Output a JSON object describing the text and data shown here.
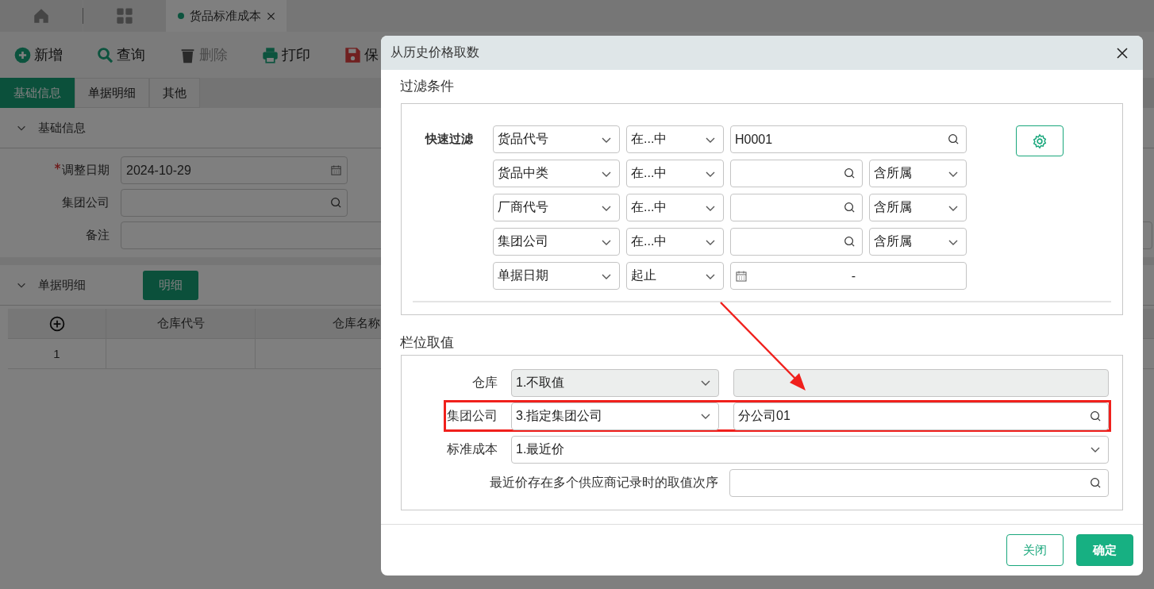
{
  "app_tabs": [
    {
      "kind": "home",
      "selected": false
    },
    {
      "kind": "apps",
      "selected": false
    },
    {
      "kind": "page",
      "label": "货品标准成本",
      "selected": true
    }
  ],
  "toolbar": [
    {
      "label": "新增",
      "disabled": false
    },
    {
      "label": "查询",
      "disabled": false
    },
    {
      "label": "删除",
      "disabled": true
    },
    {
      "label": "打印",
      "disabled": false
    },
    {
      "label": "保",
      "disabled": false
    }
  ],
  "form_tabs": [
    {
      "label": "基础信息",
      "selected": true
    },
    {
      "label": "单据明细",
      "selected": false
    },
    {
      "label": "其他",
      "selected": false
    }
  ],
  "basic_section": {
    "title": "基础信息",
    "expanded": true,
    "fields": [
      {
        "label": "调整日期",
        "required": true,
        "value": "2024-10-29",
        "kind": "date"
      },
      {
        "label": "集团公司",
        "required": false,
        "kind": "lookup"
      },
      {
        "label": "备注",
        "required": false,
        "kind": "text"
      }
    ]
  },
  "detail_section": {
    "title": "单据明细",
    "expanded": true,
    "button": "明细",
    "table": {
      "columns": [
        "仓库代号",
        "仓库名称"
      ],
      "rows": [
        {
          "number": "1"
        }
      ]
    }
  },
  "dialog": {
    "title": "从历史价格取数",
    "filter": {
      "title": "过滤条件",
      "label": "快速过滤",
      "rows": [
        {
          "field": "货品代号",
          "operator": "在...中",
          "value": "H0001",
          "kind": "lookup"
        },
        {
          "field": "货品中类",
          "operator": "在...中",
          "scope": "含所属",
          "kind": "lookup_scope"
        },
        {
          "field": "厂商代号",
          "operator": "在...中",
          "scope": "含所属",
          "kind": "lookup_scope"
        },
        {
          "field": "集团公司",
          "operator": "在...中",
          "scope": "含所属",
          "kind": "lookup_scope"
        },
        {
          "field": "单据日期",
          "operator": "起止",
          "separator": "-",
          "kind": "date_range"
        }
      ]
    },
    "columns": {
      "title": "栏位取值",
      "rows": [
        {
          "label": "仓库",
          "option": "1.不取值",
          "kind": "select_input",
          "disabled": true,
          "highlighted": false
        },
        {
          "label": "集团公司",
          "option": "3.指定集团公司",
          "value": "分公司01",
          "kind": "select_lookup",
          "disabled": false,
          "highlighted": true
        },
        {
          "label": "标准成本",
          "option": "1.最近价",
          "kind": "select",
          "disabled": false,
          "highlighted": false
        },
        {
          "label": "最近价存在多个供应商记录时的取值次序",
          "kind": "lookup",
          "disabled": false,
          "highlighted": false
        }
      ]
    },
    "buttons": [
      {
        "label": "关闭",
        "kind": "secondary"
      },
      {
        "label": "确定",
        "kind": "primary"
      }
    ]
  }
}
